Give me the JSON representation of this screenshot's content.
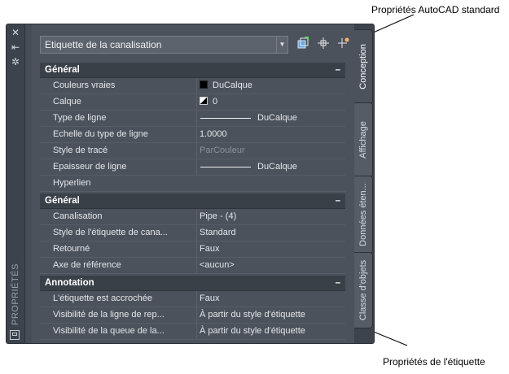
{
  "callouts": {
    "top": "Propriétés AutoCAD standard",
    "bottom": "Propriétés de l'étiquette"
  },
  "palette": {
    "title": "PROPRIÉTÉS",
    "dropdown_value": "Etiquette de la canalisation",
    "tabs": [
      "Conception",
      "Affichage",
      "Données éten...",
      "Classe d'objets"
    ]
  },
  "sections": {
    "general1": {
      "title": "Général",
      "rows": [
        {
          "name": "Couleurs vraies",
          "value": "DuCalque"
        },
        {
          "name": "Calque",
          "value": "0"
        },
        {
          "name": "Type de ligne",
          "value": "DuCalque"
        },
        {
          "name": "Echelle du type de ligne",
          "value": "1.0000"
        },
        {
          "name": "Style de tracé",
          "value": "ParCouleur"
        },
        {
          "name": "Epaisseur de ligne",
          "value": "DuCalque"
        },
        {
          "name": "Hyperlien",
          "value": ""
        }
      ]
    },
    "general2": {
      "title": "Général",
      "rows": [
        {
          "name": "Canalisation",
          "value": "Pipe - (4)"
        },
        {
          "name": "Style de l'étiquette de cana...",
          "value": "Standard"
        },
        {
          "name": "Retourné",
          "value": "Faux"
        },
        {
          "name": "Axe de référence",
          "value": "<aucun>"
        }
      ]
    },
    "annotation": {
      "title": "Annotation",
      "rows": [
        {
          "name": "L'étiquette est accrochée",
          "value": "Faux"
        },
        {
          "name": "Visibilité de la ligne de rep...",
          "value": "À partir du style d'étiquette"
        },
        {
          "name": "Visibilité de la queue de la...",
          "value": "À partir du style d'étiquette"
        }
      ]
    }
  },
  "collapse_symbol": "–",
  "icons": [
    "close-icon",
    "auto-hide-icon",
    "settings-icon",
    "quick-select-icon",
    "select-objects-icon",
    "toggle-pickadd-icon"
  ]
}
